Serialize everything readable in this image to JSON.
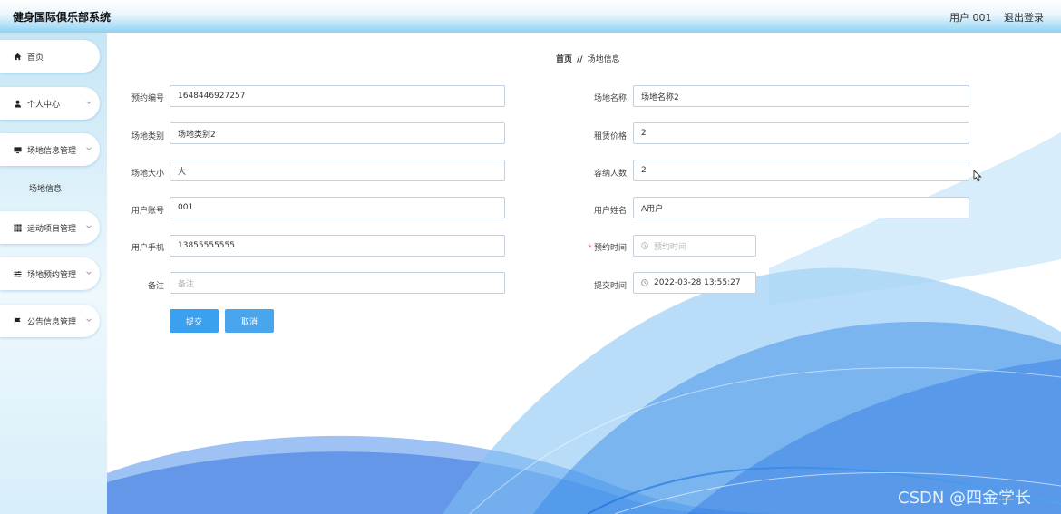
{
  "header": {
    "app_title": "健身国际俱乐部系统",
    "user_label": "用户 001",
    "logout_label": "退出登录"
  },
  "sidebar": {
    "items": [
      {
        "label": "首页",
        "icon": "home-icon"
      },
      {
        "label": "个人中心",
        "icon": "user-icon"
      },
      {
        "label": "场地信息管理",
        "icon": "monitor-icon"
      },
      {
        "label": "运动项目管理",
        "icon": "grid-icon"
      },
      {
        "label": "场地预约管理",
        "icon": "sliders-icon"
      },
      {
        "label": "公告信息管理",
        "icon": "flag-icon"
      }
    ],
    "sub_item": "场地信息"
  },
  "breadcrumb": {
    "home": "首页",
    "separator": "//",
    "current": "场地信息"
  },
  "form": {
    "booking_no": {
      "label": "预约编号",
      "value": "1648446927257"
    },
    "venue_name": {
      "label": "场地名称",
      "value": "场地名称2"
    },
    "venue_type": {
      "label": "场地类别",
      "value": "场地类别2"
    },
    "rent_price": {
      "label": "租赁价格",
      "value": "2"
    },
    "venue_size": {
      "label": "场地大小",
      "value": "大"
    },
    "capacity": {
      "label": "容纳人数",
      "value": "2"
    },
    "user_account": {
      "label": "用户账号",
      "value": "001"
    },
    "user_name": {
      "label": "用户姓名",
      "value": "A用户"
    },
    "user_phone": {
      "label": "用户手机",
      "value": "13855555555"
    },
    "booking_time": {
      "label": "预约时间",
      "required_mark": "*",
      "placeholder": "预约时间"
    },
    "remark": {
      "label": "备注",
      "placeholder": "备注"
    },
    "submit_time": {
      "label": "提交时间",
      "value": "2022-03-28 13:55:27"
    }
  },
  "buttons": {
    "submit": "提交",
    "cancel": "取消"
  },
  "watermark": "CSDN @四金学长",
  "colors": {
    "accent": "#3aa0f0",
    "header_gradient_end": "#8fd1f3",
    "required": "#f56c6c"
  }
}
